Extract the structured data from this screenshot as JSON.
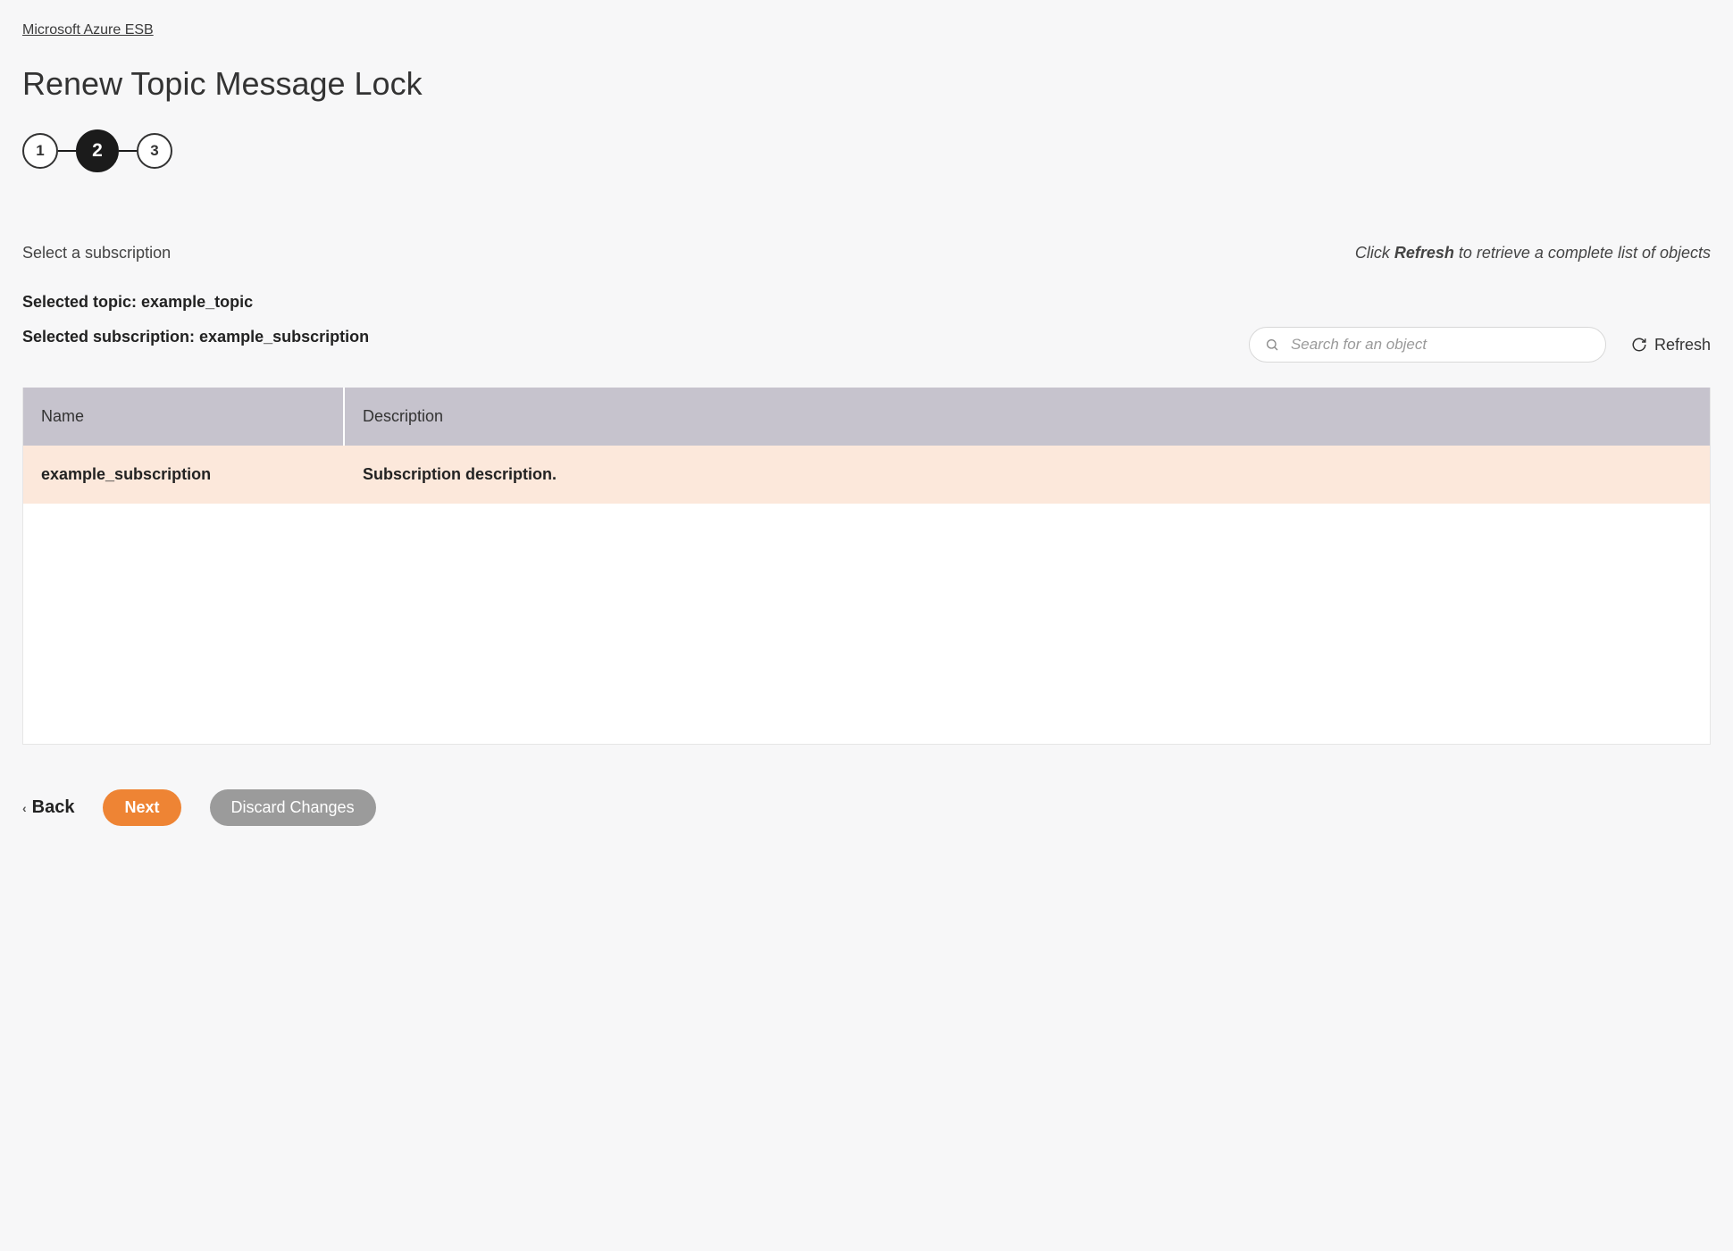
{
  "breadcrumb": "Microsoft Azure ESB",
  "page_title": "Renew Topic Message Lock",
  "stepper": {
    "steps": [
      "1",
      "2",
      "3"
    ],
    "active_index": 1
  },
  "section": {
    "select_label": "Select a subscription",
    "hint_prefix": "Click ",
    "hint_bold": "Refresh",
    "hint_suffix": " to retrieve a complete list of objects",
    "selected_topic_label": "Selected topic: ",
    "selected_topic_value": "example_topic",
    "selected_subscription_label": "Selected subscription: ",
    "selected_subscription_value": "example_subscription"
  },
  "search": {
    "placeholder": "Search for an object"
  },
  "refresh_label": "Refresh",
  "table": {
    "headers": {
      "name": "Name",
      "description": "Description"
    },
    "rows": [
      {
        "name": "example_subscription",
        "description": "Subscription description."
      }
    ]
  },
  "footer": {
    "back": "Back",
    "next": "Next",
    "discard": "Discard Changes"
  }
}
